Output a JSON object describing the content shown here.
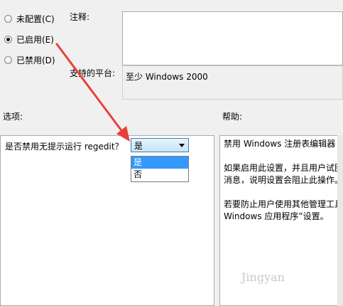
{
  "state": {
    "options": [
      {
        "label": "未配置(C)",
        "checked": false
      },
      {
        "label": "已启用(E)",
        "checked": true
      },
      {
        "label": "已禁用(D)",
        "checked": false
      }
    ]
  },
  "comment": {
    "label": "注释:",
    "value": ""
  },
  "platform": {
    "label": "支持的平台:",
    "value": "至少 Windows 2000"
  },
  "options_panel": {
    "label": "选项:",
    "question": "是否禁用无提示运行 regedit？",
    "combo_value": "是",
    "dropdown_options": [
      "是",
      "否"
    ]
  },
  "help": {
    "label": "帮助:",
    "lines": [
      "禁用 Windows 注册表编辑器 R",
      "",
      "如果启用此设置，并且用户试图",
      "消息，说明设置会阻止此操作。",
      "",
      "若要防止用户使用其他管理工具",
      "Windows 应用程序”设置。"
    ]
  },
  "watermark": "Jingyan",
  "colors": {
    "arrow": "#e8413a",
    "selection": "#3399ff"
  }
}
